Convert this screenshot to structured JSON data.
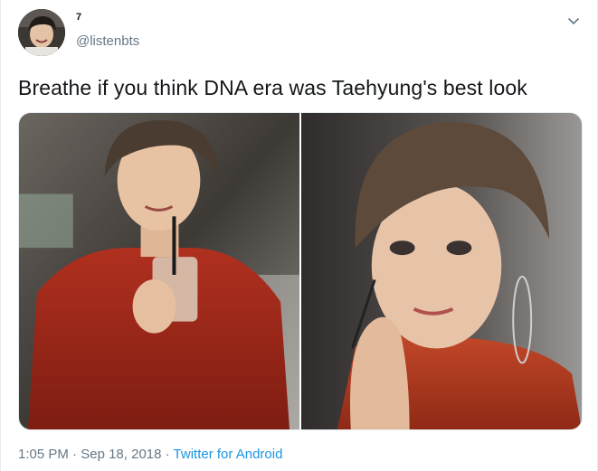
{
  "user": {
    "display_name": "7",
    "handle": "@listenbts"
  },
  "icons": {
    "menu": "chevron-down-icon"
  },
  "tweet": {
    "text": "Breathe if you think DNA era was Taehyung's best look"
  },
  "media": {
    "photo_count": 2
  },
  "meta": {
    "time": "1:05 PM",
    "separator": " · ",
    "date": "Sep 18, 2018",
    "source": "Twitter for Android"
  },
  "colors": {
    "text_primary": "#14171a",
    "text_secondary": "#657786",
    "link": "#1b95e0",
    "border": "#e6ecf0"
  }
}
